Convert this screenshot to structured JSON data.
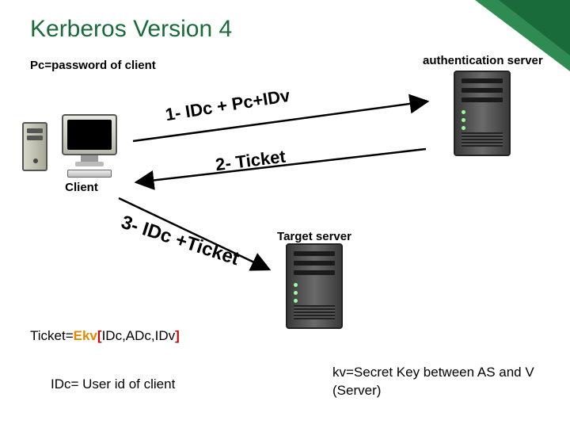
{
  "title": "Kerberos Version 4",
  "subtitle": "Pc=password of client",
  "nodes": {
    "client_label": "Client",
    "auth_label": "authentication server",
    "target_label": "Target server"
  },
  "messages": {
    "step1": "1- IDc + Pc+IDv",
    "step2": "2- Ticket",
    "step3": "3- IDc +Ticket"
  },
  "ticket": {
    "prefix": "Ticket=",
    "ek": "Ekv",
    "lbracket": "[",
    "body": "IDc,ADc,IDv",
    "rbracket": "]"
  },
  "notes": {
    "idc": "IDc= User id of client",
    "kv": "kv=Secret Key between AS and V (Server)"
  },
  "colors": {
    "accent": "#1a6b3a",
    "ek": "#e08a00",
    "bracket": "#c00"
  }
}
